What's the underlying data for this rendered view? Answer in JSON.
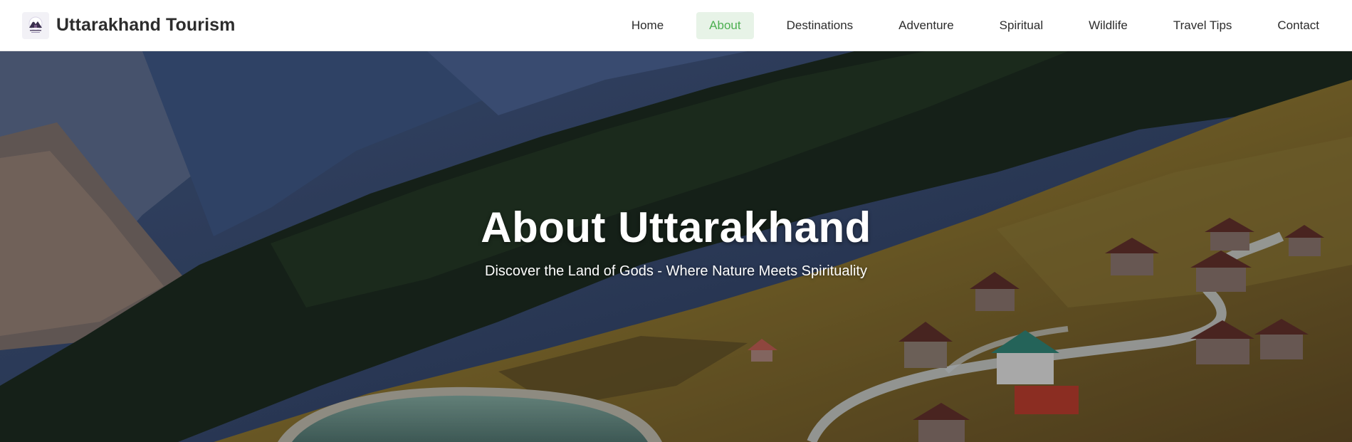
{
  "brand": {
    "title": "Uttarakhand Tourism",
    "logo_icon": "mountain-temple-logo-icon"
  },
  "nav": {
    "items": [
      {
        "label": "Home",
        "active": false
      },
      {
        "label": "About",
        "active": true
      },
      {
        "label": "Destinations",
        "active": false
      },
      {
        "label": "Adventure",
        "active": false
      },
      {
        "label": "Spiritual",
        "active": false
      },
      {
        "label": "Wildlife",
        "active": false
      },
      {
        "label": "Travel Tips",
        "active": false
      },
      {
        "label": "Contact",
        "active": false
      }
    ],
    "active_color": "#4caf50",
    "active_background": "#e7f3e7"
  },
  "hero": {
    "title": "About Uttarakhand",
    "subtitle": "Discover the Land of Gods - Where Nature Meets Spirituality",
    "image": "mountain-valley-with-lake-and-cottages"
  }
}
